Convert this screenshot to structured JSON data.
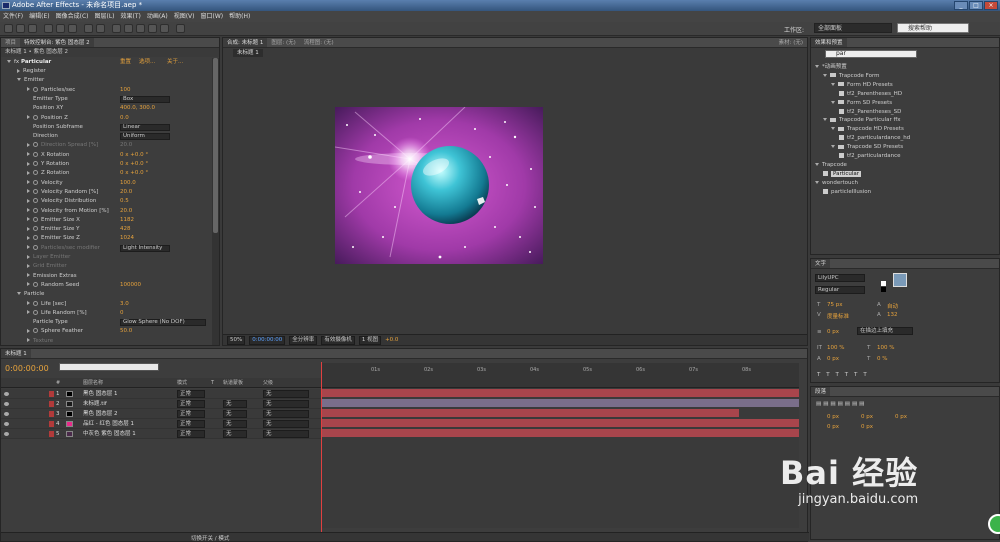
{
  "app": {
    "title": "Adobe After Effects - 未命名项目.aep *",
    "window_buttons": [
      "_",
      "□",
      "×"
    ]
  },
  "menu": [
    "文件(F)",
    "编辑(E)",
    "图像合成(C)",
    "图层(L)",
    "效果(T)",
    "动画(A)",
    "视图(V)",
    "窗口(W)",
    "帮助(H)"
  ],
  "toolbar": {
    "workspace_label": "工作区:",
    "workspace_value": "全部面板",
    "help_placeholder": "搜索帮助"
  },
  "effect_controls": {
    "tabs": [
      "项目",
      "特效控制台: 紫色 固态层 2"
    ],
    "sub_header": "未标题 1 • 紫色 固态层 2",
    "plugin": {
      "name": "Particular",
      "reset": "重置",
      "options": "选项...",
      "about": "关于..."
    },
    "rows": [
      {
        "label": "Register",
        "indent": 1,
        "type": "section"
      },
      {
        "label": "Emitter",
        "indent": 1,
        "type": "section-open"
      },
      {
        "label": "Particles/sec",
        "indent": 2,
        "value": "100"
      },
      {
        "label": "Emitter Type",
        "indent": 3,
        "value": "Box",
        "type": "dropdown"
      },
      {
        "label": "Position XY",
        "indent": 3,
        "value": "400.0, 300.0"
      },
      {
        "label": "Position Z",
        "indent": 2,
        "value": "0.0"
      },
      {
        "label": "Position Subframe",
        "indent": 3,
        "value": "Linear",
        "type": "dropdown"
      },
      {
        "label": "Direction",
        "indent": 3,
        "value": "Uniform",
        "type": "dropdown"
      },
      {
        "label": "Direction Spread [%]",
        "indent": 2,
        "value": "20.0",
        "dim": true
      },
      {
        "label": "X Rotation",
        "indent": 2,
        "value": "0 x +0.0 °"
      },
      {
        "label": "Y Rotation",
        "indent": 2,
        "value": "0 x +0.0 °"
      },
      {
        "label": "Z Rotation",
        "indent": 2,
        "value": "0 x +0.0 °"
      },
      {
        "label": "Velocity",
        "indent": 2,
        "value": "100.0"
      },
      {
        "label": "Velocity Random [%]",
        "indent": 2,
        "value": "20.0"
      },
      {
        "label": "Velocity Distribution",
        "indent": 2,
        "value": "0.5"
      },
      {
        "label": "Velocity from Motion [%]",
        "indent": 2,
        "value": "20.0"
      },
      {
        "label": "Emitter Size X",
        "indent": 2,
        "value": "1182"
      },
      {
        "label": "Emitter Size Y",
        "indent": 2,
        "value": "428"
      },
      {
        "label": "Emitter Size Z",
        "indent": 2,
        "value": "1024"
      },
      {
        "label": "Particles/sec modifier",
        "indent": 2,
        "value": "Light Intensity",
        "type": "dropdown",
        "dim": true
      },
      {
        "label": "Layer Emitter",
        "indent": 2,
        "type": "section",
        "dim": true
      },
      {
        "label": "Grid Emitter",
        "indent": 2,
        "type": "section",
        "dim": true
      },
      {
        "label": "Emission Extras",
        "indent": 2,
        "type": "section"
      },
      {
        "label": "Random Seed",
        "indent": 2,
        "value": "100000"
      },
      {
        "label": "Particle",
        "indent": 1,
        "type": "section-open"
      },
      {
        "label": "Life [sec]",
        "indent": 2,
        "value": "3.0"
      },
      {
        "label": "Life Random [%]",
        "indent": 2,
        "value": "0"
      },
      {
        "label": "Particle Type",
        "indent": 3,
        "value": "Glow Sphere (No DOF)",
        "type": "dropdown-wide"
      },
      {
        "label": "Sphere Feather",
        "indent": 2,
        "value": "50.0"
      },
      {
        "label": "Texture",
        "indent": 2,
        "type": "section",
        "dim": true
      }
    ]
  },
  "composition": {
    "tabs": [
      "合成: 未标题 1",
      "图层: (无)",
      "流程图: (无)"
    ],
    "active_comp": "未标题 1",
    "bottom_bar": [
      "50%",
      "0:00:00:00",
      "全分辨率",
      "有效摄像机",
      "1 视图",
      "+0.0"
    ]
  },
  "footage_panel": {
    "tab": "素材: (无)"
  },
  "effects_presets": {
    "tab": "效果和预置",
    "search_value": "par",
    "tree": [
      {
        "label": "*动画预置",
        "indent": 0,
        "kind": "open"
      },
      {
        "label": "Trapcode Form",
        "indent": 1,
        "kind": "folder"
      },
      {
        "label": "Form HD Presets",
        "indent": 2,
        "kind": "folder"
      },
      {
        "label": "tf2_Parentheses_HD",
        "indent": 3,
        "kind": "fx"
      },
      {
        "label": "Form SD Presets",
        "indent": 2,
        "kind": "folder"
      },
      {
        "label": "tf2_Parentheses_SD",
        "indent": 3,
        "kind": "fx"
      },
      {
        "label": "Trapcode Particular ffx",
        "indent": 1,
        "kind": "folder"
      },
      {
        "label": "Trapcode HD Presets",
        "indent": 2,
        "kind": "folder"
      },
      {
        "label": "tf2_particulardance_hd",
        "indent": 3,
        "kind": "fx"
      },
      {
        "label": "Trapcode SD Presets",
        "indent": 2,
        "kind": "folder"
      },
      {
        "label": "tf2_particulardance",
        "indent": 3,
        "kind": "fx"
      },
      {
        "label": "Trapcode",
        "indent": 0,
        "kind": "open"
      },
      {
        "label": "Particular",
        "indent": 1,
        "kind": "fx-selected"
      },
      {
        "label": "wondertouch",
        "indent": 0,
        "kind": "open"
      },
      {
        "label": "particleIllusion",
        "indent": 1,
        "kind": "fx"
      }
    ]
  },
  "text_panel": {
    "tab": "文字",
    "font": "LilyUPC",
    "style": "Regular",
    "size": "75 px",
    "leading": "自动",
    "kerning": "度量标准",
    "tracking": "132",
    "stroke_width": "0 px",
    "stroke_type": "在描边上填充",
    "vscale": "100 %",
    "hscale": "100 %",
    "baseline": "0 px",
    "tsume": "0 %"
  },
  "paragraph_panel": {
    "tab": "段落",
    "indents": [
      "0 px",
      "0 px",
      "0 px",
      "0 px",
      "0 px"
    ]
  },
  "timeline": {
    "tabs": [
      "未标题 1"
    ],
    "current_time": "0:00:00:00",
    "headers": [
      "#",
      "图层名称",
      "模式",
      "T",
      "轨道蒙板",
      "父级"
    ],
    "layers": [
      {
        "num": "1",
        "name": "黑色 固态层 1",
        "mode": "正常",
        "track": "",
        "parent": "无",
        "color": "#000000"
      },
      {
        "num": "2",
        "name": "未标题.tif",
        "mode": "正常",
        "track": "无",
        "parent": "无",
        "color": "#1a1a1a"
      },
      {
        "num": "3",
        "name": "黑色 固态层 2",
        "mode": "正常",
        "track": "无",
        "parent": "无",
        "color": "#000000"
      },
      {
        "num": "4",
        "name": "品红 - 红色 固态层 1",
        "mode": "正常",
        "track": "无",
        "parent": "无",
        "color": "#e82a8a"
      },
      {
        "num": "5",
        "name": "中灰色 紫色 固态层 1",
        "mode": "正常",
        "track": "无",
        "parent": "无",
        "color": "#4a2a4a"
      }
    ],
    "ruler_ticks": [
      "01s",
      "02s",
      "03s",
      "04s",
      "05s",
      "06s",
      "07s",
      "08s"
    ],
    "bottom_label": "切换开关 / 模式"
  },
  "watermark": {
    "main": "Bai 经验",
    "url": "jingyan.baidu.com"
  }
}
